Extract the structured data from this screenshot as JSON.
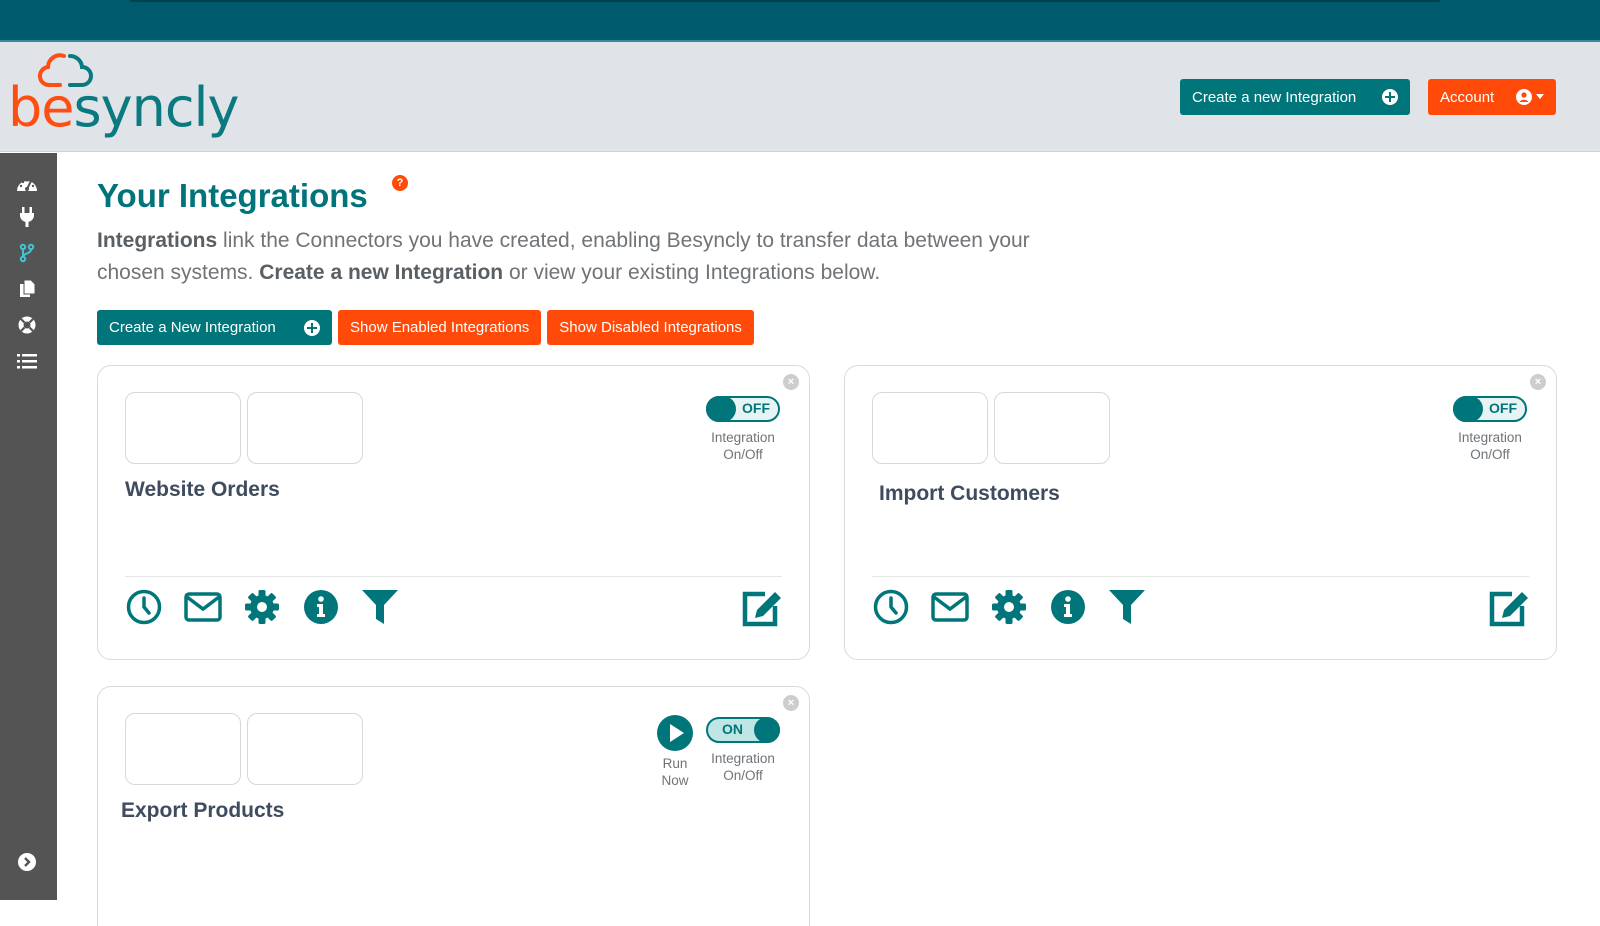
{
  "brand": {
    "prefix": "be",
    "suffix": "syncly",
    "orange": "#ff4a0a",
    "teal": "#00767a",
    "topbar": "#005a6e"
  },
  "header": {
    "create_label": "Create a new Integration",
    "account_label": "Account"
  },
  "sidebar": {
    "items": [
      {
        "name": "dashboard",
        "icon": "speedometer-icon"
      },
      {
        "name": "connectors",
        "icon": "plug-icon"
      },
      {
        "name": "integrations",
        "icon": "branch-icon",
        "active": true
      },
      {
        "name": "documents",
        "icon": "copy-icon"
      },
      {
        "name": "support",
        "icon": "lifebuoy-icon"
      },
      {
        "name": "logs",
        "icon": "list-icon"
      }
    ],
    "expand_icon": "chevron-right-circle-icon"
  },
  "main": {
    "title": "Your Integrations",
    "help": "?",
    "intro": {
      "b1": "Integrations",
      "t1": " link the Connectors you have created, enabling Besyncly to transfer data between your chosen systems. ",
      "b2": "Create a new Integration",
      "t2": " or view your existing Integrations below."
    },
    "actions": {
      "create": "Create a New Integration",
      "show_enabled": "Show Enabled Integrations",
      "show_disabled": "Show Disabled Integrations"
    },
    "toggle_caption_1": "Integration",
    "toggle_caption_2": "On/Off",
    "run_caption_1": "Run",
    "run_caption_2": "Now",
    "close_glyph": "×",
    "integrations": [
      {
        "name": "Website Orders",
        "status": "OFF",
        "enabled": false,
        "run_now": false
      },
      {
        "name": "Import Customers",
        "status": "OFF",
        "enabled": false,
        "run_now": false
      },
      {
        "name": "Export Products",
        "status": "ON",
        "enabled": true,
        "run_now": true
      }
    ]
  }
}
